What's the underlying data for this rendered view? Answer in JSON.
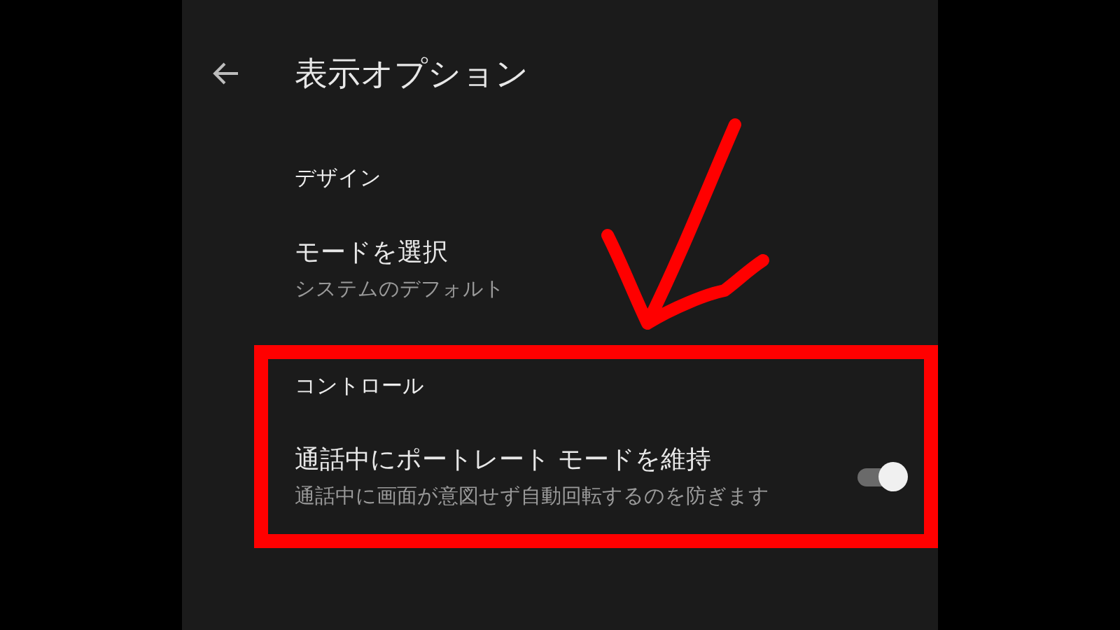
{
  "app_bar": {
    "title": "表示オプション"
  },
  "sections": [
    {
      "header": "デザイン",
      "items": [
        {
          "kind": "value",
          "title": "モードを選択",
          "subtitle": "システムのデフォルト"
        }
      ]
    },
    {
      "header": "コントロール",
      "items": [
        {
          "kind": "toggle",
          "title": "通話中にポートレート モードを維持",
          "subtitle": "通話中に画面が意図せず自動回転するのを防ぎます",
          "on": true
        }
      ]
    }
  ]
}
